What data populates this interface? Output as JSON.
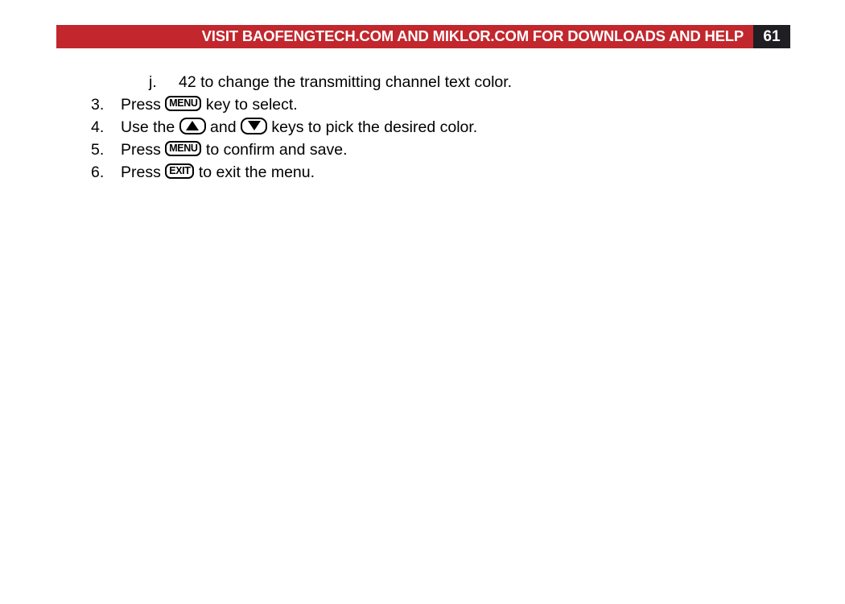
{
  "header": {
    "title": "VISIT BAOFENGTECH.COM AND MIKLOR.COM FOR DOWNLOADS AND HELP",
    "page_number": "61",
    "banner_color": "#c1272d",
    "page_box_color": "#1e1e23",
    "banner_text_color": "#ffffff"
  },
  "content": {
    "sub_item": {
      "marker": "j.",
      "text": "42 to change the transmitting channel text color."
    },
    "steps": [
      {
        "number": "3.",
        "prefix": "Press ",
        "key": {
          "type": "text",
          "label": "MENU",
          "name": "menu-key"
        },
        "suffix": " key to select."
      },
      {
        "number": "4.",
        "prefix": "Use the ",
        "key": {
          "type": "arrow-up",
          "label": "▲",
          "name": "up-arrow-key"
        },
        "middle": " and ",
        "key2": {
          "type": "arrow-down",
          "label": "▼",
          "name": "down-arrow-key"
        },
        "suffix": " keys to pick the desired color."
      },
      {
        "number": "5.",
        "prefix": "Press ",
        "key": {
          "type": "text",
          "label": "MENU",
          "name": "menu-key"
        },
        "suffix": " to confirm and save."
      },
      {
        "number": "6.",
        "prefix": "Press ",
        "key": {
          "type": "text",
          "label": "EXIT",
          "name": "exit-key"
        },
        "suffix": " to exit the menu."
      }
    ]
  }
}
